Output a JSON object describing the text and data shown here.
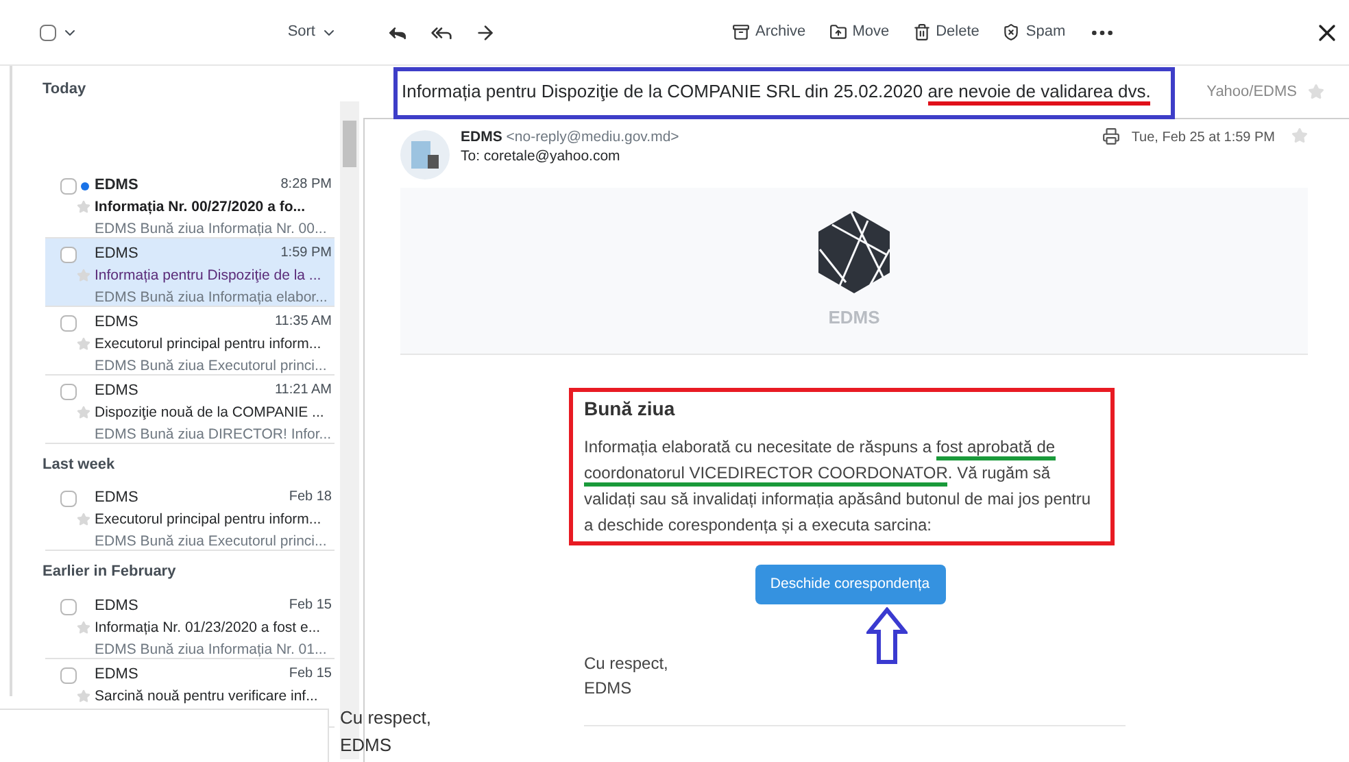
{
  "toolbar": {
    "select_all": {
      "checked": false
    },
    "sort_label": "Sort",
    "actions": [
      {
        "kind": "archive",
        "label": "Archive"
      },
      {
        "kind": "move",
        "label": "Move"
      },
      {
        "kind": "delete",
        "label": "Delete"
      },
      {
        "kind": "spam",
        "label": "Spam"
      }
    ]
  },
  "groups": [
    {
      "title": "Today",
      "items": [
        {
          "sender": "EDMS",
          "time": "8:28 PM",
          "subject": "Informația Nr. 00/27/2020 a fo...",
          "preview": "EDMS Bună ziua Informația Nr. 00...",
          "unread": true,
          "selected": false
        },
        {
          "sender": "EDMS",
          "time": "1:59 PM",
          "subject": "Informația pentru Dispoziţie de la ...",
          "preview": "EDMS Bună ziua Informația elabor...",
          "unread": false,
          "selected": true
        },
        {
          "sender": "EDMS",
          "time": "11:35 AM",
          "subject": "Executorul principal pentru inform...",
          "preview": "EDMS Bună ziua Executorul princi...",
          "unread": false,
          "selected": false
        },
        {
          "sender": "EDMS",
          "time": "11:21 AM",
          "subject": "Dispoziţie nouă de la COMPANIE ...",
          "preview": "EDMS Bună ziua DIRECTOR! Infor...",
          "unread": false,
          "selected": false
        }
      ]
    },
    {
      "title": "Last week",
      "items": [
        {
          "sender": "EDMS",
          "time": "Feb 18",
          "subject": "Executorul principal pentru inform...",
          "preview": "EDMS Bună ziua Executorul princi...",
          "unread": false,
          "selected": false
        }
      ]
    },
    {
      "title": "Earlier in February",
      "items": [
        {
          "sender": "EDMS",
          "time": "Feb 15",
          "subject": "Informația Nr. 01/23/2020 a fost e...",
          "preview": "EDMS Bună ziua Informația Nr. 01...",
          "unread": false,
          "selected": false
        },
        {
          "sender": "EDMS",
          "time": "Feb 15",
          "subject": "Sarcină nouă pentru verificare inf...",
          "unread": false,
          "selected": false
        }
      ]
    }
  ],
  "message": {
    "subject": [
      {
        "text": "Informația pentru Dispoziţie de la COMPANIE SRL din 25.02.2020 "
      },
      {
        "text": "are nevoie de validarea dvs.",
        "color": "#e0101a"
      }
    ],
    "folder": "Yahoo/EDMS",
    "from_name": "EDMS",
    "from_address": "<no-reply@mediu.gov.md>",
    "to": "To: coretale@yahoo.com",
    "date": "Tue, Feb 25 at 1:59 PM",
    "logo_text": "EDMS",
    "greeting": "Bună ziua",
    "body": [
      {
        "text": "Informația elaborată cu necesitate de răspuns a "
      },
      {
        "text": "fost aprobată de coordonatorul VICEDIRECTOR COORDONATOR",
        "color": "#1a9a3a"
      },
      {
        "text": ". Vă rugăm să validați sau să invalidați informația apăsând butonul de mai jos pentru a deschide corespondența și a executa sarcina:"
      }
    ],
    "button": "Deschide corespondența",
    "closing": "Cu respect,",
    "signature": "EDMS"
  },
  "stray_text": [
    "Cu respect,",
    "EDMS"
  ]
}
